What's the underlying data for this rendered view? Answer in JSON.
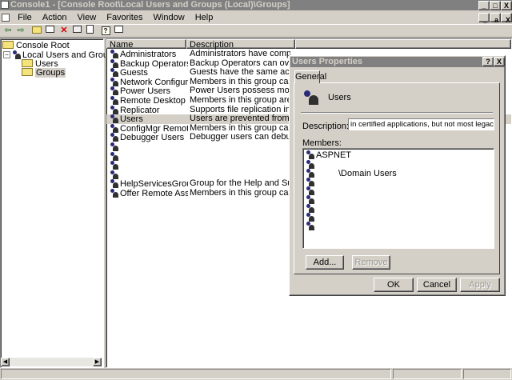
{
  "window": {
    "title": "Console1 - [Console Root\\Local Users and Groups (Local)\\Groups]",
    "controls": [
      "_",
      "□",
      "X"
    ],
    "inner_controls": [
      "_",
      "a",
      "X"
    ]
  },
  "menu": [
    "File",
    "Action",
    "View",
    "Favorites",
    "Window",
    "Help"
  ],
  "toolbar": [
    "back-icon",
    "forward-icon",
    "up-folder-icon",
    "show-hide-tree-icon",
    "delete-icon",
    "properties-icon",
    "export-icon",
    "help-icon",
    "console-icon"
  ],
  "tree": {
    "root": "Console Root",
    "node": "Local Users and Groups (Local)",
    "children": [
      "Users",
      "Groups"
    ]
  },
  "list": {
    "columns": [
      "Name",
      "Description"
    ],
    "rows": [
      {
        "name": "Administrators",
        "desc": "Administrators have complete and u..."
      },
      {
        "name": "Backup Operators",
        "desc": "Backup Operators can override secu..."
      },
      {
        "name": "Guests",
        "desc": "Guests have the same access as me..."
      },
      {
        "name": "Network Configuration ...",
        "desc": "Members in this group can have som..."
      },
      {
        "name": "Power Users",
        "desc": "Power Users possess most administr..."
      },
      {
        "name": "Remote Desktop Users",
        "desc": "Members in this group are granted t..."
      },
      {
        "name": "Replicator",
        "desc": "Supports file replication in a domain"
      },
      {
        "name": "Users",
        "desc": "Users are prevented from making ac..."
      },
      {
        "name": "ConfigMgr Remote Con...",
        "desc": "Members in this group can view and ..."
      },
      {
        "name": "Debugger Users",
        "desc": "Debugger users can debug processe..."
      },
      {
        "name": "",
        "desc": ""
      },
      {
        "name": "",
        "desc": ""
      },
      {
        "name": "",
        "desc": ""
      },
      {
        "name": "",
        "desc": ""
      },
      {
        "name": "HelpServicesGroup",
        "desc": "Group for the Help and Support Cente"
      },
      {
        "name": "Offer Remote Assistanc...",
        "desc": "Members in this group can offer Rem..."
      }
    ]
  },
  "dialog": {
    "title": "Users Properties",
    "help": "?",
    "close": "X",
    "tab": "General",
    "group_name": "Users",
    "description_label": "Description:",
    "description_value": "in certified applications, but not most legacy applications",
    "members_label": "Members:",
    "members": [
      "ASPNET",
      "",
      "\\Domain Users",
      "",
      "",
      "",
      "",
      "",
      ""
    ],
    "add": "Add...",
    "remove": "Remove",
    "ok": "OK",
    "cancel": "Cancel",
    "apply": "Apply"
  }
}
